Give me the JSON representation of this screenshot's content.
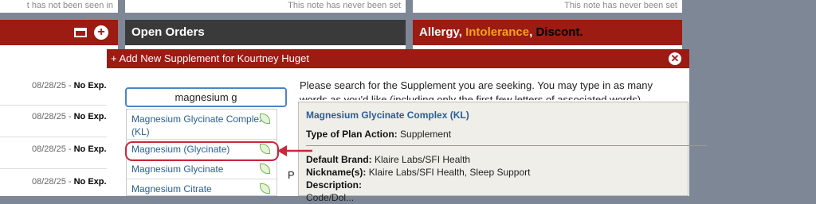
{
  "top_notes": {
    "left": "t has not been seen in person",
    "middle": "This note has never been set",
    "right": "This note has never been set"
  },
  "panels": {
    "open_orders_title": "Open Orders",
    "allergy": {
      "allergy": "Allergy,",
      "intolerance": "Intolerance",
      "comma": ",",
      "discont": "Discont."
    }
  },
  "left_rows": [
    {
      "date": "08/28/25 - ",
      "status": "No Exp."
    },
    {
      "date": "08/28/25 - ",
      "status": "No Exp."
    },
    {
      "date": "08/28/25 - ",
      "status": "No Exp."
    },
    {
      "date": "08/28/25 - ",
      "status": "No Exp."
    }
  ],
  "dialog": {
    "title": "+ Add New Supplement for Kourtney Huget",
    "search_value": "magnesium g",
    "instructions": "Please search for the Supplement you are seeking. You may type in as many words as you'd like (including only the first few letters of associated words).",
    "suggestions": [
      {
        "label_line1": "Magnesium Glycinate Complex",
        "label_line2": "(KL)"
      },
      {
        "label": "Magnesium (Glycinate)"
      },
      {
        "label": "Magnesium Glycinate"
      },
      {
        "label": "Magnesium Citrate"
      }
    ],
    "partial_text": "P"
  },
  "tooltip": {
    "name": "Magnesium Glycinate Complex (KL)",
    "type_label": "Type of Plan Action:",
    "type_value": "Supplement",
    "brand_label": "Default Brand:",
    "brand_value": "Klaire Labs/SFI Health",
    "nick_label": "Nickname(s):",
    "nick_value": "Klaire Labs/SFI Health, Sleep Support",
    "desc_label": "Description:",
    "cut_text": "Code/Dol..."
  },
  "colors": {
    "header_red": "#9c1b12",
    "header_dark": "#3a3a3a",
    "link_blue": "#2a5d98",
    "highlight_red": "#c8283c",
    "intolerance_orange": "#f2a41e",
    "leaf_green": "#74b84e"
  },
  "icons": [
    "window-icon",
    "plus-circle-icon",
    "close-circle-icon",
    "leaf-icon",
    "arrow-left-icon"
  ]
}
